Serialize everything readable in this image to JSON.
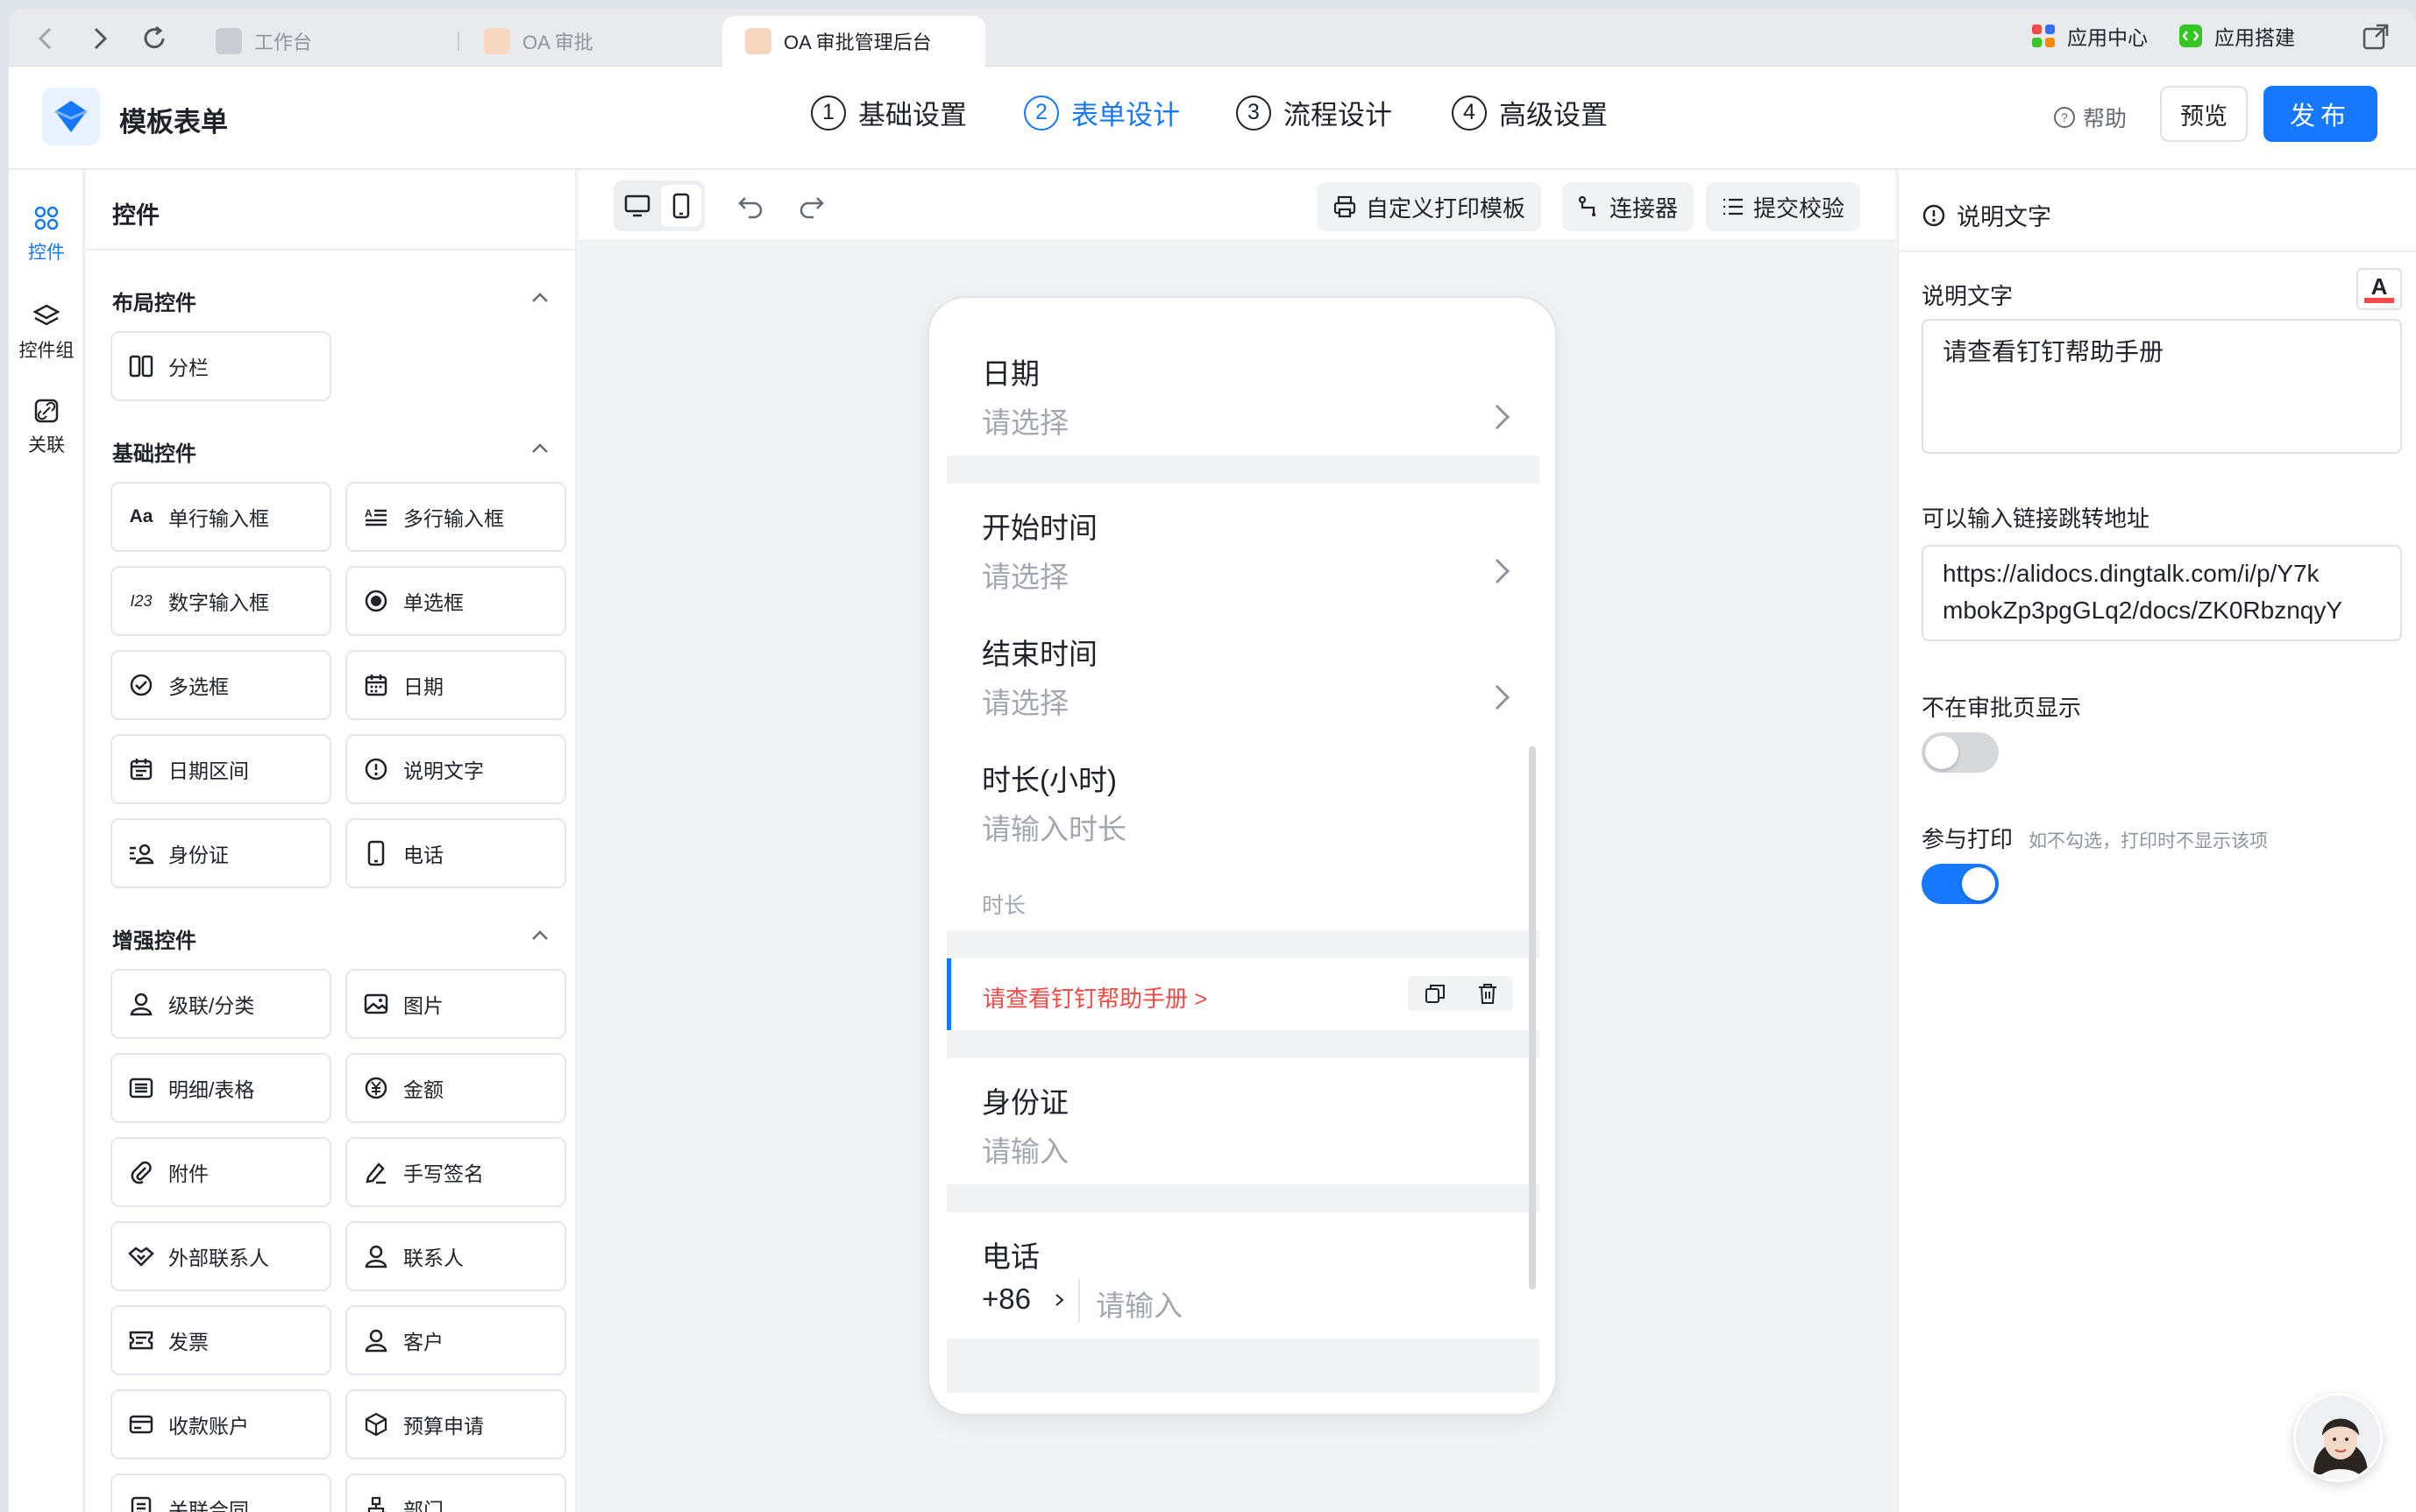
{
  "browser": {
    "tabs": [
      {
        "label": "工作台"
      },
      {
        "label": "OA 审批"
      },
      {
        "label": "OA 审批管理后台"
      }
    ],
    "right_links": [
      {
        "label": "应用中心"
      },
      {
        "label": "应用搭建"
      }
    ]
  },
  "header": {
    "app_title": "模板表单",
    "steps": [
      {
        "num": "1",
        "label": "基础设置"
      },
      {
        "num": "2",
        "label": "表单设计"
      },
      {
        "num": "3",
        "label": "流程设计"
      },
      {
        "num": "4",
        "label": "高级设置"
      }
    ],
    "active_step": 2,
    "help": "帮助",
    "preview": "预览",
    "publish": "发布"
  },
  "rail": {
    "items": [
      {
        "label": "控件",
        "icon": "grid-icon"
      },
      {
        "label": "控件组",
        "icon": "layers-icon"
      },
      {
        "label": "关联",
        "icon": "link-icon"
      }
    ]
  },
  "panel": {
    "title": "控件",
    "sections": [
      {
        "title": "布局控件",
        "items": [
          {
            "label": "分栏",
            "icon": "columns-icon"
          }
        ]
      },
      {
        "title": "基础控件",
        "items": [
          {
            "label": "单行输入框",
            "icon": "text-icon",
            "glyph": "Aa"
          },
          {
            "label": "多行输入框",
            "icon": "multiline-icon"
          },
          {
            "label": "数字输入框",
            "icon": "number-icon",
            "glyph": "I23"
          },
          {
            "label": "单选框",
            "icon": "radio-icon"
          },
          {
            "label": "多选框",
            "icon": "checkbox-icon"
          },
          {
            "label": "日期",
            "icon": "calendar-icon"
          },
          {
            "label": "日期区间",
            "icon": "date-range-icon"
          },
          {
            "label": "说明文字",
            "icon": "info-icon"
          },
          {
            "label": "身份证",
            "icon": "id-card-icon"
          },
          {
            "label": "电话",
            "icon": "phone-icon"
          }
        ]
      },
      {
        "title": "增强控件",
        "items": [
          {
            "label": "级联/分类",
            "icon": "cascade-icon"
          },
          {
            "label": "图片",
            "icon": "image-icon"
          },
          {
            "label": "明细/表格",
            "icon": "table-icon"
          },
          {
            "label": "金额",
            "icon": "money-icon"
          },
          {
            "label": "附件",
            "icon": "attachment-icon"
          },
          {
            "label": "手写签名",
            "icon": "signature-icon"
          },
          {
            "label": "外部联系人",
            "icon": "handshake-icon"
          },
          {
            "label": "联系人",
            "icon": "user-icon"
          },
          {
            "label": "发票",
            "icon": "invoice-icon"
          },
          {
            "label": "客户",
            "icon": "customer-icon"
          },
          {
            "label": "收款账户",
            "icon": "card-icon"
          },
          {
            "label": "预算申请",
            "icon": "box-icon"
          },
          {
            "label": "关联合同",
            "icon": "contract-icon"
          },
          {
            "label": "部门",
            "icon": "org-icon"
          }
        ]
      }
    ]
  },
  "toolbar": {
    "print_template": "自定义打印模板",
    "connector": "连接器",
    "validation": "提交校验"
  },
  "form": {
    "date": {
      "label": "日期",
      "placeholder": "请选择"
    },
    "start": {
      "label": "开始时间",
      "placeholder": "请选择"
    },
    "end": {
      "label": "结束时间",
      "placeholder": "请选择"
    },
    "duration": {
      "label": "时长(小时)",
      "placeholder": "请输入时长",
      "hint": "时长"
    },
    "note": {
      "text": "请查看钉钉帮助手册 >"
    },
    "idcard": {
      "label": "身份证",
      "placeholder": "请输入"
    },
    "phone": {
      "label": "电话",
      "code": "+86",
      "placeholder": "请输入"
    }
  },
  "props": {
    "header": "说明文字",
    "desc_label": "说明文字",
    "desc_value": "请查看钉钉帮助手册",
    "link_label": "可以输入链接跳转地址",
    "link_line1": "https://alidocs.dingtalk.com/i/p/Y7k",
    "link_line2": "mbokZp3pgGLq2/docs/ZK0RbznqyY",
    "hide_label": "不在审批页显示",
    "hide_on": false,
    "print_label": "参与打印",
    "print_hint": "如不勾选，打印时不显示该项",
    "print_on": true
  },
  "colors": {
    "accent": "#1677ff",
    "note_red": "#f54a45"
  }
}
